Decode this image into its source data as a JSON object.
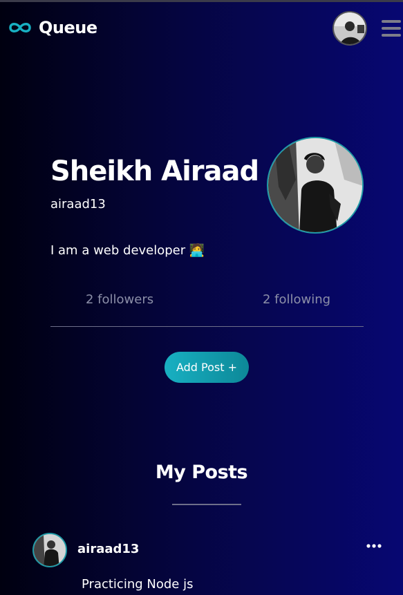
{
  "app": {
    "brand": "Queue",
    "brand_icon": "infinity-icon"
  },
  "nav": {
    "avatar_icon": "user-avatar",
    "menu_icon": "hamburger-icon"
  },
  "profile": {
    "name": "Sheikh Airaad",
    "handle": "airaad13",
    "bio": "I am a web developer 🧑‍💻",
    "followers": "2 followers",
    "following": "2 following",
    "add_post_label": "Add Post +"
  },
  "posts_section": {
    "title": "My Posts"
  },
  "posts": [
    {
      "user": "airaad13",
      "text": "Practicing Node js",
      "more_icon": "more-dots-icon"
    }
  ],
  "colors": {
    "accent": "#18b0c2",
    "background_left": "#000010",
    "background_right": "#070772",
    "muted_text": "#8c8fa8"
  }
}
